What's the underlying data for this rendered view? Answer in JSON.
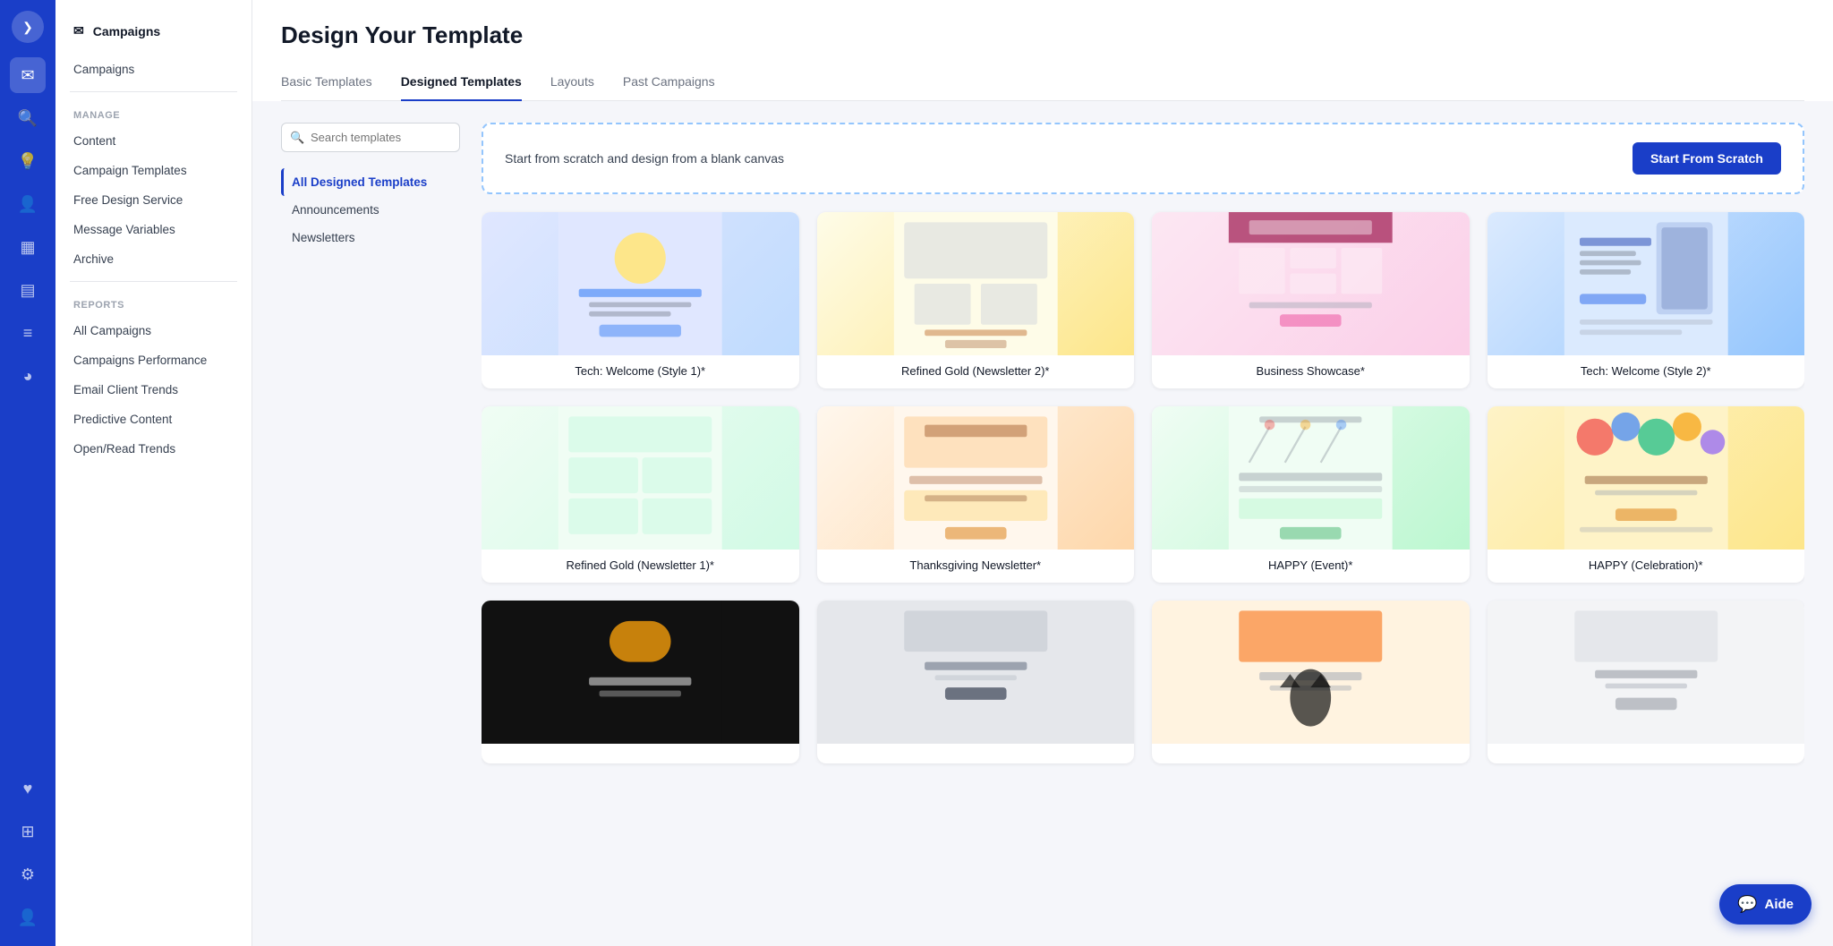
{
  "iconSidebar": {
    "chevron": "❯",
    "icons": [
      {
        "name": "mail-icon",
        "symbol": "✉",
        "active": true
      },
      {
        "name": "search-icon-nav",
        "symbol": "🔍",
        "active": false
      },
      {
        "name": "bulb-icon",
        "symbol": "💡",
        "active": false
      },
      {
        "name": "user-icon",
        "symbol": "👤",
        "active": false
      },
      {
        "name": "dashboard-icon",
        "symbol": "▦",
        "active": false
      },
      {
        "name": "chart-bar-icon",
        "symbol": "▤",
        "active": false
      },
      {
        "name": "list-icon",
        "symbol": "≡",
        "active": false
      },
      {
        "name": "pie-icon",
        "symbol": "◕",
        "active": false
      }
    ],
    "bottomIcons": [
      {
        "name": "heart-icon",
        "symbol": "♥",
        "active": false
      },
      {
        "name": "grid-plus-icon",
        "symbol": "⊞",
        "active": false
      },
      {
        "name": "gear-icon",
        "symbol": "⚙",
        "active": false
      },
      {
        "name": "avatar-icon",
        "symbol": "👤",
        "active": false
      }
    ]
  },
  "navSidebar": {
    "topItem": {
      "label": "Campaigns",
      "icon": "✉"
    },
    "topNavItems": [
      {
        "label": "Campaigns",
        "active": false
      }
    ],
    "manageSection": "MANAGE",
    "manageItems": [
      {
        "label": "Content",
        "active": false
      },
      {
        "label": "Campaign Templates",
        "active": false
      },
      {
        "label": "Free Design Service",
        "active": false
      },
      {
        "label": "Message Variables",
        "active": false
      },
      {
        "label": "Archive",
        "active": false
      }
    ],
    "reportsSection": "REPORTS",
    "reportsItems": [
      {
        "label": "All Campaigns",
        "active": false
      },
      {
        "label": "Campaigns Performance",
        "active": false
      },
      {
        "label": "Email Client Trends",
        "active": false
      },
      {
        "label": "Predictive Content",
        "active": false
      },
      {
        "label": "Open/Read Trends",
        "active": false
      }
    ]
  },
  "page": {
    "title": "Design Your Template",
    "tabs": [
      {
        "label": "Basic Templates",
        "active": false
      },
      {
        "label": "Designed Templates",
        "active": true
      },
      {
        "label": "Layouts",
        "active": false
      },
      {
        "label": "Past Campaigns",
        "active": false
      }
    ]
  },
  "search": {
    "placeholder": "Search templates"
  },
  "filters": [
    {
      "label": "All Designed Templates",
      "active": true
    },
    {
      "label": "Announcements",
      "active": false
    },
    {
      "label": "Newsletters",
      "active": false
    }
  ],
  "scratchBanner": {
    "text": "Start from scratch and design from a blank canvas",
    "buttonLabel": "Start From Scratch"
  },
  "templates": [
    {
      "name": "Tech: Welcome (Style 1)*",
      "colorClass": "tech1",
      "id": "tpl-1"
    },
    {
      "name": "Refined Gold (Newsletter 2)*",
      "colorClass": "gold2",
      "id": "tpl-2"
    },
    {
      "name": "Business Showcase*",
      "colorClass": "biz",
      "id": "tpl-3"
    },
    {
      "name": "Tech: Welcome (Style 2)*",
      "colorClass": "tech2",
      "id": "tpl-4"
    },
    {
      "name": "Refined Gold (Newsletter 1)*",
      "colorClass": "gold1",
      "id": "tpl-5"
    },
    {
      "name": "Thanksgiving Newsletter*",
      "colorClass": "thanksgiving",
      "id": "tpl-6"
    },
    {
      "name": "HAPPY (Event)*",
      "colorClass": "event",
      "id": "tpl-7"
    },
    {
      "name": "HAPPY (Celebration)*",
      "colorClass": "celebration",
      "id": "tpl-8"
    },
    {
      "name": "",
      "colorClass": "bottom1",
      "id": "tpl-9"
    },
    {
      "name": "",
      "colorClass": "bottom2",
      "id": "tpl-10"
    },
    {
      "name": "",
      "colorClass": "bottom3",
      "id": "tpl-11"
    },
    {
      "name": "",
      "colorClass": "bottom4",
      "id": "tpl-12"
    }
  ],
  "aide": {
    "label": "Aide"
  }
}
